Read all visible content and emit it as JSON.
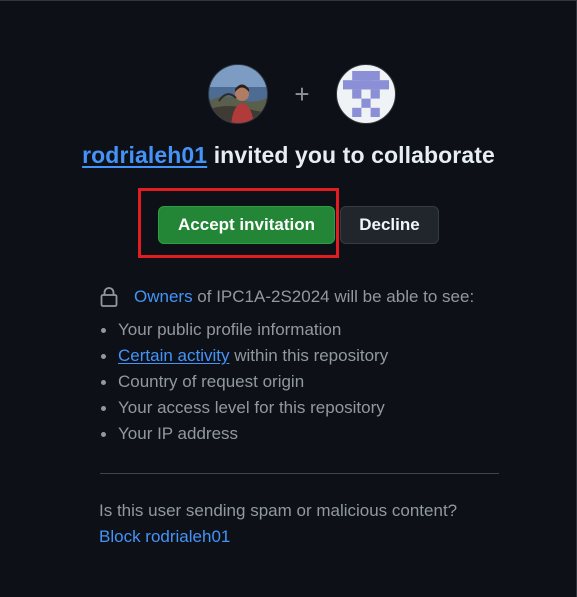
{
  "invite": {
    "plus_sign": "+",
    "inviter": "rodrialeh01",
    "title_suffix": " invited you to collaborate"
  },
  "actions": {
    "accept_label": "Accept invitation",
    "decline_label": "Decline"
  },
  "permissions": {
    "owners_link": "Owners",
    "intro_suffix": " of IPC1A-2S2024 will be able to see:",
    "items": [
      "Your public profile information",
      "Certain activity",
      "Country of request origin",
      "Your access level for this repository",
      "Your IP address"
    ],
    "item1_suffix": " within this repository"
  },
  "report": {
    "question": "Is this user sending spam or malicious content?",
    "block_label": "Block rodrialeh01"
  },
  "colors": {
    "background": "#0d1117",
    "accent_link": "#4493f8",
    "accept_green": "#238636",
    "highlight_red": "#e11d21"
  },
  "icons": {
    "lock": "lock-icon",
    "user_avatar": "user-avatar",
    "repo_avatar": "identicon-avatar"
  }
}
